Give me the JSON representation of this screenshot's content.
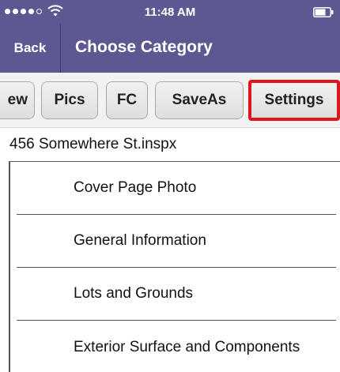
{
  "status_bar": {
    "time": "11:48 AM",
    "signal_dots_filled": 4,
    "signal_dots_total": 5,
    "icons": [
      "signal-dots-icon",
      "wifi-icon",
      "battery-icon"
    ]
  },
  "nav": {
    "back_label": "Back",
    "title": "Choose Category"
  },
  "toolbar": {
    "buttons": [
      {
        "label": "ew"
      },
      {
        "label": "Pics"
      },
      {
        "label": "FC"
      },
      {
        "label": "SaveAs"
      },
      {
        "label": "Settings",
        "highlighted": true
      }
    ]
  },
  "file": {
    "name": "456 Somewhere St.inspx"
  },
  "categories": [
    {
      "label": "Cover Page Photo"
    },
    {
      "label": "General Information"
    },
    {
      "label": "Lots and Grounds"
    },
    {
      "label": "Exterior Surface and Components"
    }
  ],
  "colors": {
    "nav_background": "#5d5892",
    "highlight": "#e0151c"
  }
}
